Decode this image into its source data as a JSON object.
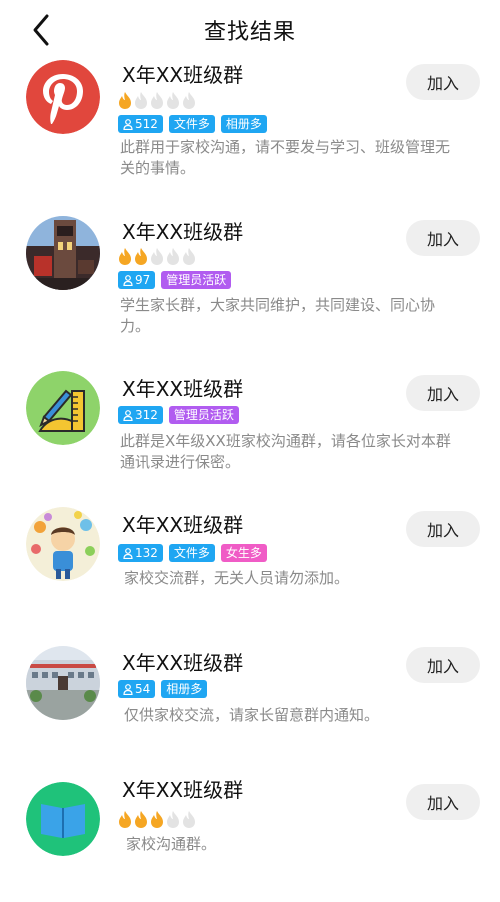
{
  "header": {
    "title": "查找结果"
  },
  "join_label": "加入",
  "items": [
    {
      "name": "X年XX班级群",
      "rating": 1,
      "tags": [
        {
          "text": "512",
          "type": "members"
        },
        {
          "text": "文件多"
        },
        {
          "text": "相册多"
        }
      ],
      "desc": "此群用于家校沟通，请不要发与学习、班级管理无关的事情。",
      "avatar": "pinterest-logo"
    },
    {
      "name": "X年XX班级群",
      "rating": 2,
      "tags": [
        {
          "text": "97",
          "type": "members"
        },
        {
          "text": "管理员活跃",
          "color": "purple"
        }
      ],
      "desc": "学生家长群，大家共同维护，共同建设、同心协力。",
      "avatar": "tower-photo"
    },
    {
      "name": "X年XX班级群",
      "tags": [
        {
          "text": "312",
          "type": "members"
        },
        {
          "text": "管理员活跃",
          "color": "purple"
        }
      ],
      "desc": "此群是X年级XX班家校沟通群，请各位家长对本群通讯录进行保密。",
      "avatar": "ruler-pencil"
    },
    {
      "name": "X年XX班级群",
      "tags": [
        {
          "text": "132",
          "type": "members"
        },
        {
          "text": "文件多"
        },
        {
          "text": "女生多",
          "color": "pink"
        }
      ],
      "desc": "家校交流群，无关人员请勿添加。",
      "avatar": "boy-cartoon"
    },
    {
      "name": "X年XX班级群",
      "tags": [
        {
          "text": "54",
          "type": "members"
        },
        {
          "text": "相册多"
        }
      ],
      "desc": "仅供家校交流，请家长留意群内通知。",
      "avatar": "school-building"
    },
    {
      "name": "X年XX班级群",
      "rating": 3,
      "tags": [],
      "desc": "家校沟通群。",
      "avatar": "book-icon"
    }
  ]
}
